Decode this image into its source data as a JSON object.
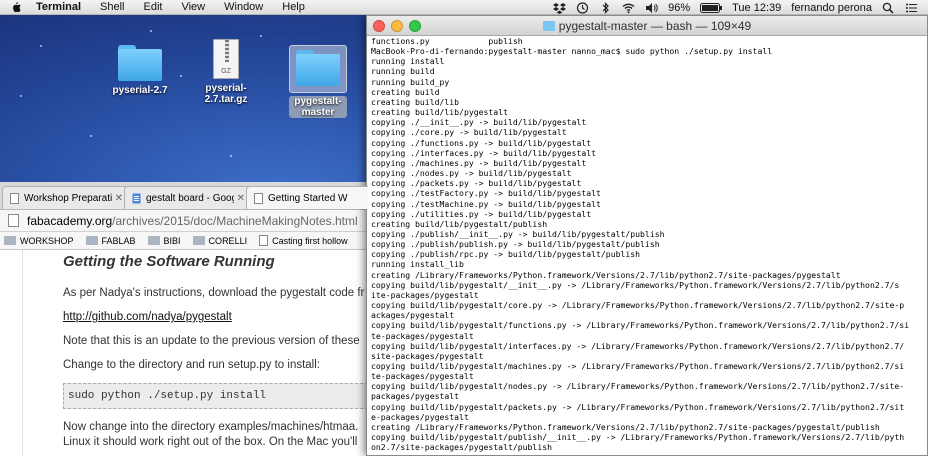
{
  "menubar": {
    "app": "Terminal",
    "menus": [
      "Shell",
      "Edit",
      "View",
      "Window",
      "Help"
    ],
    "battery": "96%",
    "clock": "Tue 12:39",
    "user": "fernando perona"
  },
  "desktop": {
    "icons": [
      {
        "label": "pyserial-2.7"
      },
      {
        "label": "pyserial-2.7.tar.gz",
        "badge": "GZ"
      },
      {
        "label": "pygestalt-master"
      }
    ]
  },
  "browser": {
    "tabs": [
      {
        "title": "Workshop Preparation"
      },
      {
        "title": "gestalt board - Google Doc"
      },
      {
        "title": "Getting Started W"
      }
    ],
    "url_domain": "fabacademy.org",
    "url_path": "/archives/2015/doc/MachineMakingNotes.html",
    "bookmarks": [
      "WORKSHOP",
      "FABLAB",
      "BIBI",
      "CORELLI",
      "Casting first hollow"
    ],
    "page": {
      "heading": "Getting the Software Running",
      "p1": "As per Nadya's instructions, download the pygestalt code fr",
      "link": "http://github.com/nadya/pygestalt",
      "p2": "Note that this is an update to the previous version of these",
      "p3": "Change to the directory and run setup.py to install:",
      "code": "sudo python ./setup.py install",
      "p4": "Now change into the directory examples/machines/htmaa.",
      "p5": "Linux it should work right out of the box. On the Mac you'll"
    }
  },
  "terminal": {
    "title": "pygestalt-master — bash — 109×49",
    "lines": [
      "functions.py            publish",
      "MacBook-Pro-di-fernando:pygestalt-master nanno_mac$ sudo python ./setup.py install",
      "running install",
      "running build",
      "running build_py",
      "creating build",
      "creating build/lib",
      "creating build/lib/pygestalt",
      "copying ./__init__.py -> build/lib/pygestalt",
      "copying ./core.py -> build/lib/pygestalt",
      "copying ./functions.py -> build/lib/pygestalt",
      "copying ./interfaces.py -> build/lib/pygestalt",
      "copying ./machines.py -> build/lib/pygestalt",
      "copying ./nodes.py -> build/lib/pygestalt",
      "copying ./packets.py -> build/lib/pygestalt",
      "copying ./testFactory.py -> build/lib/pygestalt",
      "copying ./testMachine.py -> build/lib/pygestalt",
      "copying ./utilities.py -> build/lib/pygestalt",
      "creating build/lib/pygestalt/publish",
      "copying ./publish/__init__.py -> build/lib/pygestalt/publish",
      "copying ./publish/publish.py -> build/lib/pygestalt/publish",
      "copying ./publish/rpc.py -> build/lib/pygestalt/publish",
      "running install_lib",
      "creating /Library/Frameworks/Python.framework/Versions/2.7/lib/python2.7/site-packages/pygestalt",
      "copying build/lib/pygestalt/__init__.py -> /Library/Frameworks/Python.framework/Versions/2.7/lib/python2.7/s",
      "ite-packages/pygestalt",
      "copying build/lib/pygestalt/core.py -> /Library/Frameworks/Python.framework/Versions/2.7/lib/python2.7/site-p",
      "ackages/pygestalt",
      "copying build/lib/pygestalt/functions.py -> /Library/Frameworks/Python.framework/Versions/2.7/lib/python2.7/si",
      "te-packages/pygestalt",
      "copying build/lib/pygestalt/interfaces.py -> /Library/Frameworks/Python.framework/Versions/2.7/lib/python2.7/",
      "site-packages/pygestalt",
      "copying build/lib/pygestalt/machines.py -> /Library/Frameworks/Python.framework/Versions/2.7/lib/python2.7/si",
      "te-packages/pygestalt",
      "copying build/lib/pygestalt/nodes.py -> /Library/Frameworks/Python.framework/Versions/2.7/lib/python2.7/site-",
      "packages/pygestalt",
      "copying build/lib/pygestalt/packets.py -> /Library/Frameworks/Python.framework/Versions/2.7/lib/python2.7/sit",
      "e-packages/pygestalt",
      "creating /Library/Frameworks/Python.framework/Versions/2.7/lib/python2.7/site-packages/pygestalt/publish",
      "copying build/lib/pygestalt/publish/__init__.py -> /Library/Frameworks/Python.framework/Versions/2.7/lib/pyth",
      "on2.7/site-packages/pygestalt/publish"
    ]
  }
}
